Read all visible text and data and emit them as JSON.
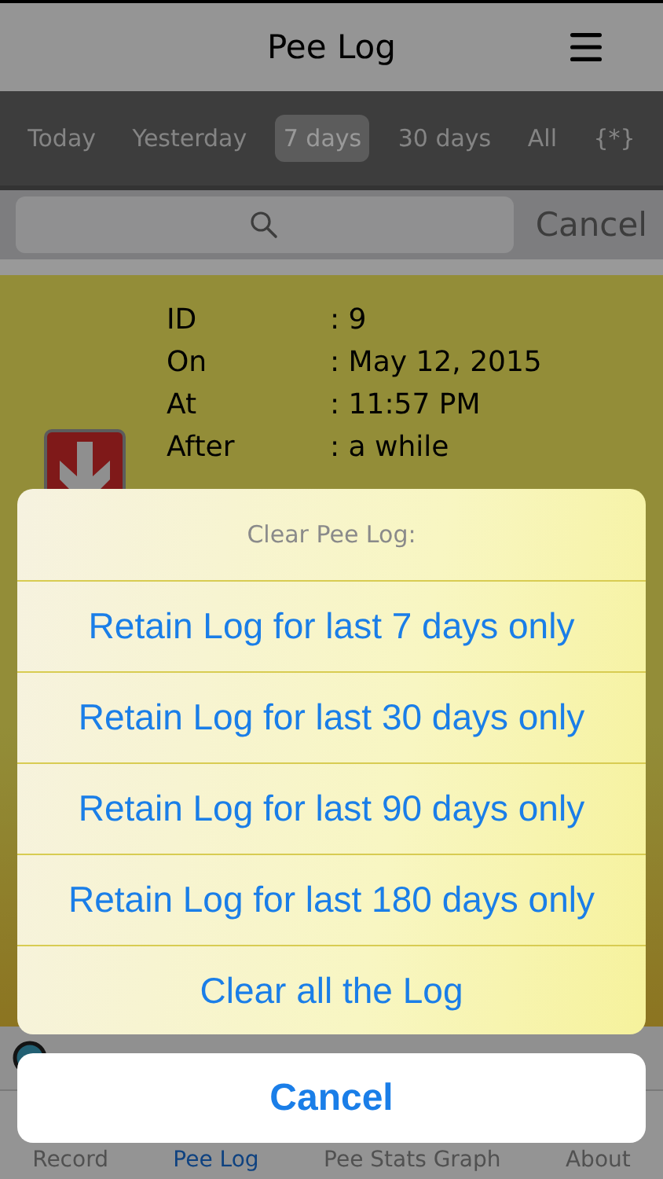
{
  "nav": {
    "title": "Pee Log"
  },
  "filters": [
    {
      "label": "Today",
      "selected": false
    },
    {
      "label": "Yesterday",
      "selected": false
    },
    {
      "label": "7 days",
      "selected": true
    },
    {
      "label": "30 days",
      "selected": false
    },
    {
      "label": "All",
      "selected": false
    },
    {
      "label": "{*}",
      "selected": false
    }
  ],
  "search": {
    "cancel": "Cancel"
  },
  "entry": {
    "fields": [
      {
        "label": "ID",
        "value": ": 9"
      },
      {
        "label": "On",
        "value": ": May 12, 2015"
      },
      {
        "label": "At",
        "value": ": 11:57 PM"
      },
      {
        "label": "After",
        "value": ": a while"
      }
    ]
  },
  "tabs": [
    {
      "label": "Record",
      "selected": false
    },
    {
      "label": "Pee Log",
      "selected": true
    },
    {
      "label": "Pee Stats Graph",
      "selected": false
    },
    {
      "label": "About",
      "selected": false
    }
  ],
  "action_sheet": {
    "title": "Clear Pee Log:",
    "options": [
      "Retain Log for last 7 days only",
      "Retain Log for last 30 days only",
      "Retain Log for last 90 days only",
      "Retain Log for last 180 days only",
      "Clear all the Log"
    ],
    "cancel": "Cancel"
  }
}
